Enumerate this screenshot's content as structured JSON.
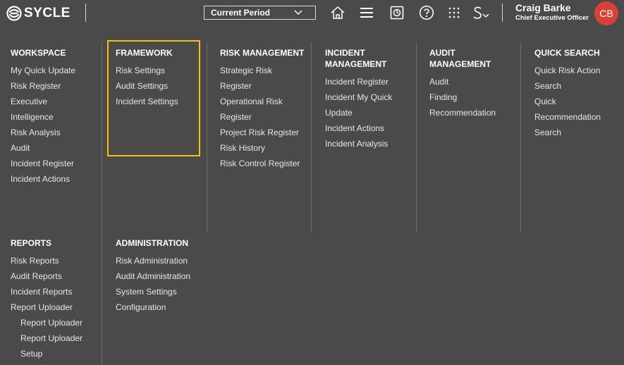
{
  "app": {
    "brand": "SYCLE"
  },
  "header": {
    "period": "Current Period",
    "user_name": "Craig Barke",
    "user_role": "Chief Executive Officer",
    "avatar_initials": "CB",
    "icons": [
      "home-icon",
      "menu-icon",
      "dashboard-icon",
      "help-icon",
      "grid-icon",
      "sycle-switcher-icon"
    ]
  },
  "menu": {
    "workspace": {
      "heading": "WORKSPACE",
      "items": [
        "My Quick Update",
        "Risk Register",
        "Executive",
        "Intelligence",
        "Risk Analysis",
        "Audit",
        "Incident Register",
        "Incident Actions"
      ]
    },
    "framework": {
      "heading": "FRAMEWORK",
      "items": [
        "Risk Settings",
        "Audit Settings",
        "Incident Settings"
      ]
    },
    "risk_management": {
      "heading": "RISK MANAGEMENT",
      "items": [
        "Strategic Risk",
        "Register",
        "Operational Risk",
        "Register",
        "Project Risk Register",
        "Risk History",
        "Risk Control Register"
      ]
    },
    "incident_management": {
      "heading_line1": "INCIDENT",
      "heading_line2": "MANAGEMENT",
      "items": [
        "Incident Register",
        "Incident My Quick",
        "Update",
        "Incident Actions",
        "Incident Analysis"
      ]
    },
    "audit_management": {
      "heading_line1": "AUDIT",
      "heading_line2": "MANAGEMENT",
      "items": [
        "Audit",
        "Finding",
        "Recommendation"
      ]
    },
    "quick_search": {
      "heading": "QUICK SEARCH",
      "items": [
        "Quick Risk Action",
        "Search",
        "Quick",
        "Recommendation",
        "Search"
      ]
    },
    "reports": {
      "heading": "REPORTS",
      "items": [
        "Risk Reports",
        "Audit Reports",
        "Incident Reports",
        "Report Uploader"
      ],
      "sub_items": [
        "Report Uploader",
        "Report Uploader",
        "Setup"
      ]
    },
    "administration": {
      "heading": "ADMINISTRATION",
      "items": [
        "Risk Administration",
        "Audit Administration",
        "System Settings",
        "Configuration"
      ]
    }
  },
  "colors": {
    "background": "#4a4a4a",
    "highlight_border": "#f2c10d",
    "avatar": "#d64238",
    "divider": "#6a6a6a"
  }
}
